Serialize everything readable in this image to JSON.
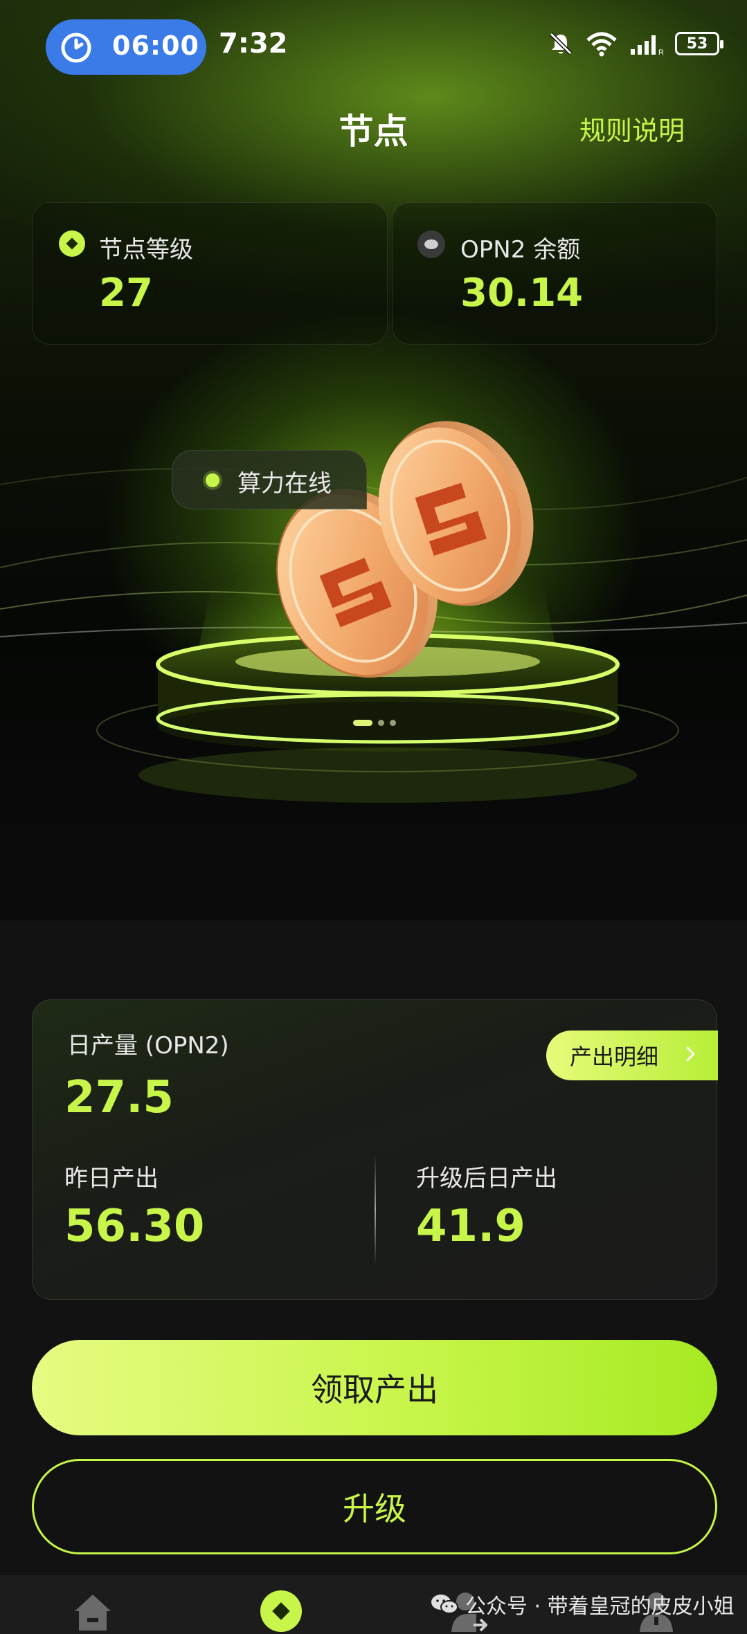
{
  "status_bar": {
    "timer": "06:00",
    "time": "7:32",
    "battery": "53"
  },
  "header": {
    "title": "节点",
    "rules_link": "规则说明"
  },
  "stats": {
    "node_level_label": "节点等级",
    "node_level_value": "27",
    "balance_label": "OPN2 余额",
    "balance_value": "30.14"
  },
  "scene": {
    "online_label": "算力在线",
    "carousel_total": 3,
    "carousel_active": 1
  },
  "production": {
    "daily_label": "日产量 (OPN2)",
    "daily_value": "27.5",
    "detail_button": "产出明细",
    "yesterday_label": "昨日产出",
    "yesterday_value": "56.30",
    "upgraded_label": "升级后日产出",
    "upgraded_value": "41.9"
  },
  "actions": {
    "claim": "领取产出",
    "upgrade": "升级"
  },
  "bottom_nav": {
    "items": [
      "home-icon",
      "node-icon",
      "transfer-icon",
      "profile-icon"
    ],
    "active": "node-icon"
  },
  "watermark": "公众号 · 带着皇冠的皮皮小姐",
  "colors": {
    "accent": "#c8f54a",
    "timer_pill": "#3a7be8",
    "coin_orange": "#e79a5a",
    "coin_logo": "#c9471f",
    "background": "#121212"
  }
}
